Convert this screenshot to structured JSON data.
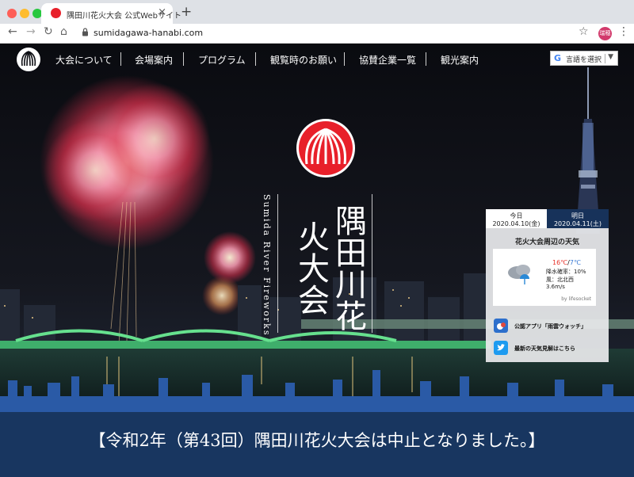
{
  "browser": {
    "tab_title": "隅田川花火大会 公式Webサイト",
    "url": "sumidagawa-hanabi.com",
    "profile": "瑞穂"
  },
  "nav": {
    "items": [
      "大会について",
      "会場案内",
      "プログラム",
      "観覧時のお願い",
      "協賛企業一覧",
      "観光案内"
    ],
    "language_selector": "言語を選択"
  },
  "hero": {
    "title_vertical": "隅田川花火大会",
    "title_english": "Sumida River Fireworks"
  },
  "weather": {
    "today_label": "今日",
    "today_date": "2020.04.10(金)",
    "tomorrow_label": "明日",
    "tomorrow_date": "2020.04.11(土)",
    "title": "花火大会周辺の天気",
    "temp_high": "16℃",
    "temp_sep": "/",
    "temp_low": "7℃",
    "rain": "降水確率：10%",
    "wind": "風：北北西",
    "wind_speed": "3.6m/s",
    "credit": "by lifesocket",
    "app_link": "公認アプリ「雨雲ウォッチ」",
    "twitter_link": "最新の天気見解はこちら"
  },
  "notice": "【令和2年（第43回）隅田川花火大会は中止となりました。】",
  "colors": {
    "brand_red": "#e8202a",
    "banner_navy": "#183660",
    "tab_active": "#17325a",
    "temp_high": "#e8322a",
    "temp_low": "#3b7bd4"
  }
}
